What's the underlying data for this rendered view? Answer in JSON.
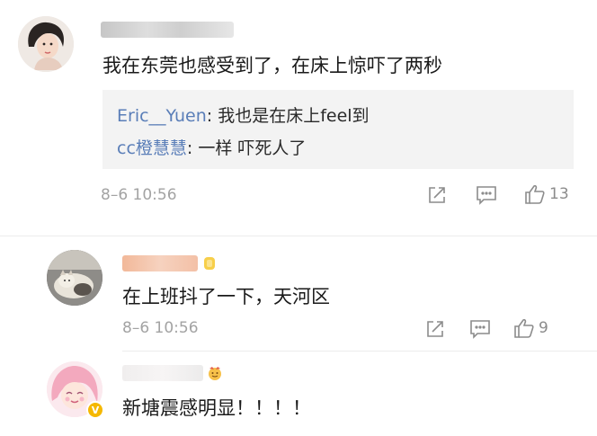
{
  "comments": [
    {
      "text": "我在东莞也感受到了，在床上惊吓了两秒",
      "replies": [
        {
          "name": "Eric__Yuen",
          "separator": ": ",
          "text": "我也是在床上feel到"
        },
        {
          "name": "cc橙慧慧",
          "separator": ": ",
          "text": "一样 吓死人了"
        }
      ],
      "time": "8–6 10:56",
      "likes": "13"
    },
    {
      "text": "在上班抖了一下，天河区",
      "time": "8–6 10:56",
      "likes": "9"
    },
    {
      "text": "新塘震感明显！！！！"
    }
  ],
  "badges": {
    "verified": "V"
  },
  "icons": [
    "share-icon",
    "comment-icon",
    "like-icon",
    "verified-badge",
    "medal-icon"
  ],
  "colors": {
    "reply_name": "#5a7eb8",
    "reply_bg": "#f3f3f3",
    "time": "#a3a3a3",
    "icon": "#8c8c8c",
    "badge": "#f5b800"
  }
}
